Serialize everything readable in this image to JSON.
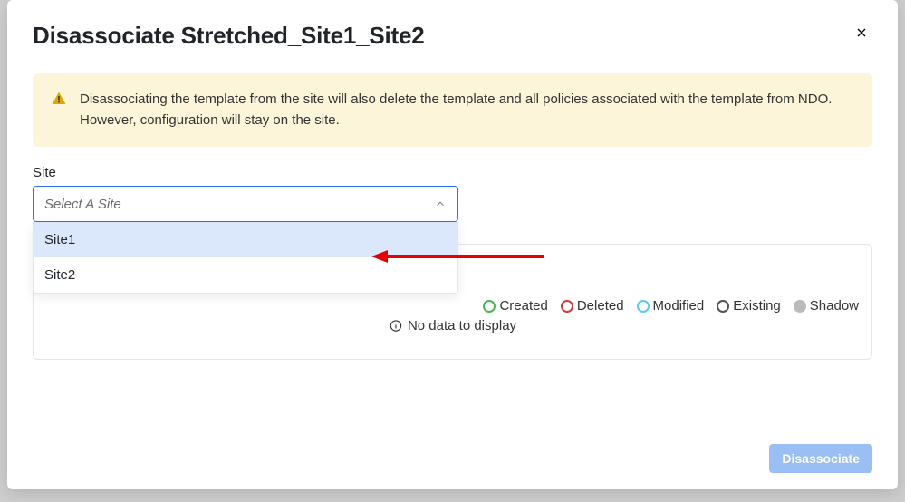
{
  "modal": {
    "title": "Disassociate Stretched_Site1_Site2"
  },
  "warning": {
    "text": "Disassociating the template from the site will also delete the template and all policies associated with the template from NDO. However, configuration will stay on the site."
  },
  "siteField": {
    "label": "Site",
    "placeholder": "Select A Site",
    "options": [
      "Site1",
      "Site2"
    ]
  },
  "legend": {
    "created": "Created",
    "deleted": "Deleted",
    "modified": "Modified",
    "existing": "Existing",
    "shadow": "Shadow"
  },
  "noData": "No data to display",
  "actions": {
    "disassociate": "Disassociate"
  }
}
